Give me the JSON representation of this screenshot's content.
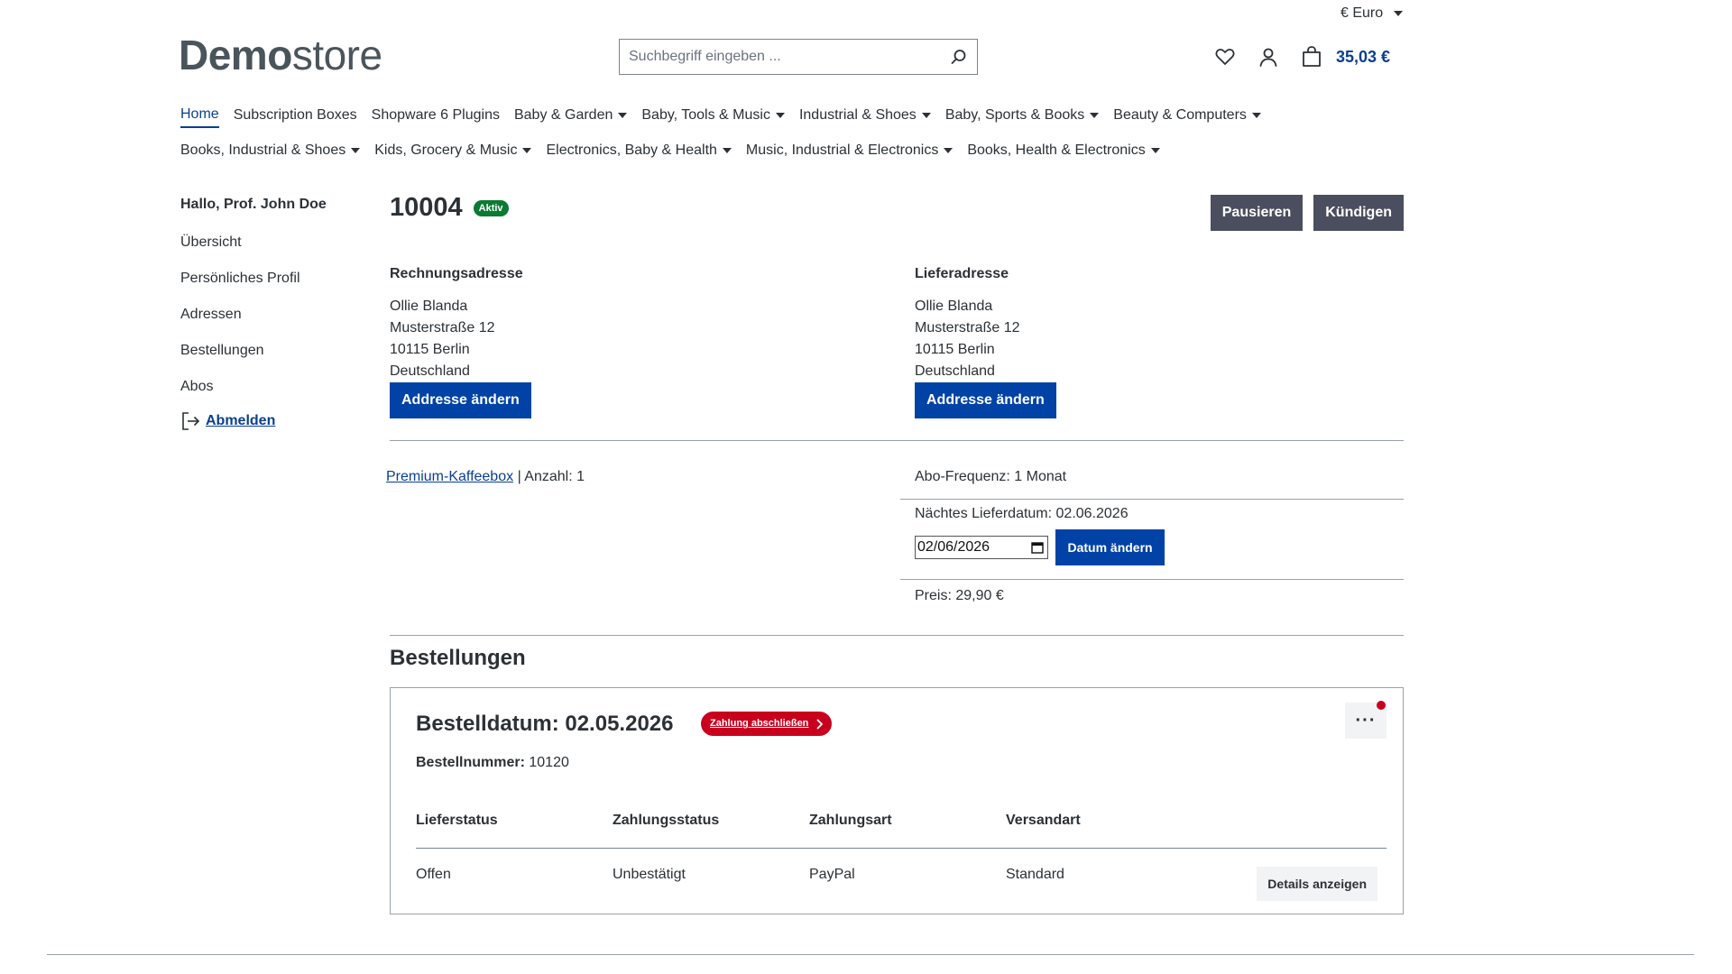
{
  "header": {
    "currency": "€ Euro",
    "logo_bold": "Demo",
    "logo_light": "store",
    "search_placeholder": "Suchbegriff eingeben ...",
    "cart_total": "35,03 €"
  },
  "nav": {
    "row1": [
      {
        "label": "Home",
        "active": true,
        "dropdown": false
      },
      {
        "label": "Subscription Boxes",
        "dropdown": false
      },
      {
        "label": "Shopware 6 Plugins",
        "dropdown": false
      },
      {
        "label": "Baby & Garden",
        "dropdown": true
      },
      {
        "label": "Baby, Tools & Music",
        "dropdown": true
      },
      {
        "label": "Industrial & Shoes",
        "dropdown": true
      },
      {
        "label": "Baby, Sports & Books",
        "dropdown": true
      },
      {
        "label": "Beauty & Computers",
        "dropdown": true
      }
    ],
    "row2": [
      {
        "label": "Books, Industrial & Shoes",
        "dropdown": true
      },
      {
        "label": "Kids, Grocery & Music",
        "dropdown": true
      },
      {
        "label": "Electronics, Baby & Health",
        "dropdown": true
      },
      {
        "label": "Music, Industrial & Electronics",
        "dropdown": true
      },
      {
        "label": "Books, Health & Electronics",
        "dropdown": true
      }
    ]
  },
  "sidebar": {
    "greeting": "Hallo, Prof. John Doe",
    "links": [
      "Übersicht",
      "Persönliches Profil",
      "Adressen",
      "Bestellungen",
      "Abos"
    ],
    "logout": "Abmelden"
  },
  "subscription": {
    "number": "10004",
    "status": "Aktiv",
    "pause_label": "Pausieren",
    "cancel_label": "Kündigen",
    "billing": {
      "heading": "Rechnungsadresse",
      "lines": [
        "Ollie Blanda",
        "Musterstraße 12",
        "10115 Berlin",
        "Deutschland"
      ],
      "button": "Addresse ändern"
    },
    "shipping": {
      "heading": "Lieferadresse",
      "lines": [
        "Ollie Blanda",
        "Musterstraße 12",
        "10115 Berlin",
        "Deutschland"
      ],
      "button": "Addresse ändern"
    },
    "product_link": "Premium-Kaffeebox",
    "quantity_text": "| Anzahl: 1",
    "frequency": "Abo-Frequenz: 1 Monat",
    "next_delivery": "Nächtes Lieferdatum: 02.06.2026",
    "date_value": "02/06/2026",
    "date_button": "Datum ändern",
    "price": "Preis: 29,90 €"
  },
  "orders": {
    "title": "Bestellungen",
    "order_date": "Bestelldatum: 02.05.2026",
    "payment_badge": "Zahlung abschließen",
    "order_number_label": "Bestellnummer:",
    "order_number": "10120",
    "columns": [
      "Lieferstatus",
      "Zahlungsstatus",
      "Zahlungsart",
      "Versandart"
    ],
    "row": [
      "Offen",
      "Unbestätigt",
      "PayPal",
      "Standard"
    ],
    "details_button": "Details anzeigen",
    "more_icon": "···"
  },
  "colors": {
    "primary": "#0042a6",
    "active_badge": "#0c7a33",
    "alert": "#c8001e",
    "dark_button": "#4a4e5e"
  }
}
